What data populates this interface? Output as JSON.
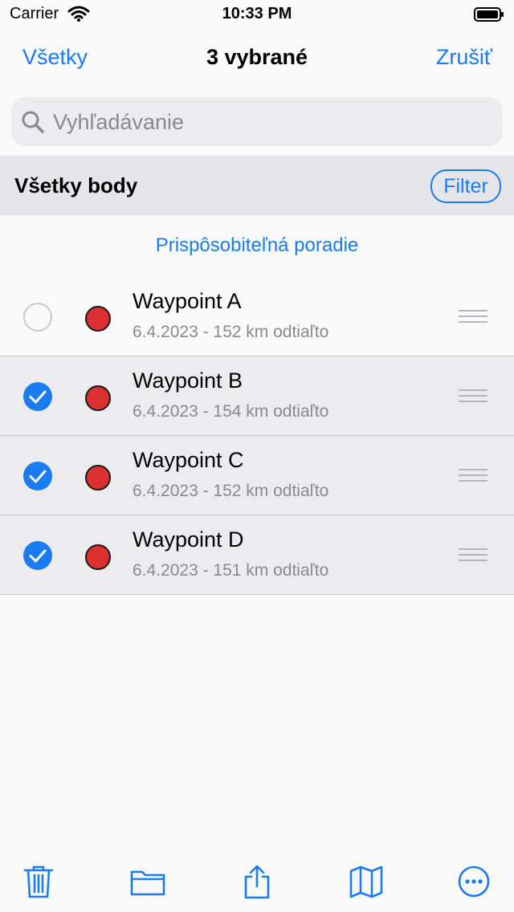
{
  "status": {
    "carrier": "Carrier",
    "time": "10:33 PM"
  },
  "nav": {
    "left": "Všetky",
    "title": "3 vybrané",
    "right": "Zrušiť"
  },
  "search": {
    "placeholder": "Vyhľadávanie"
  },
  "section": {
    "title": "Všetky body",
    "filter": "Filter"
  },
  "order_link": "Prispôsobiteľná poradie",
  "waypoints": [
    {
      "title": "Waypoint A",
      "subtitle": "6.4.2023 - 152 km odtiaľto",
      "selected": false
    },
    {
      "title": "Waypoint B",
      "subtitle": "6.4.2023 - 154 km odtiaľto",
      "selected": true
    },
    {
      "title": "Waypoint C",
      "subtitle": "6.4.2023 - 152 km odtiaľto",
      "selected": true
    },
    {
      "title": "Waypoint D",
      "subtitle": "6.4.2023 - 151 km odtiaľto",
      "selected": true
    }
  ],
  "colors": {
    "accent": "#1a7cf0",
    "dot": "#dc2f2f"
  },
  "toolbar": [
    "trash-icon",
    "folder-icon",
    "share-icon",
    "map-icon",
    "more-icon"
  ]
}
